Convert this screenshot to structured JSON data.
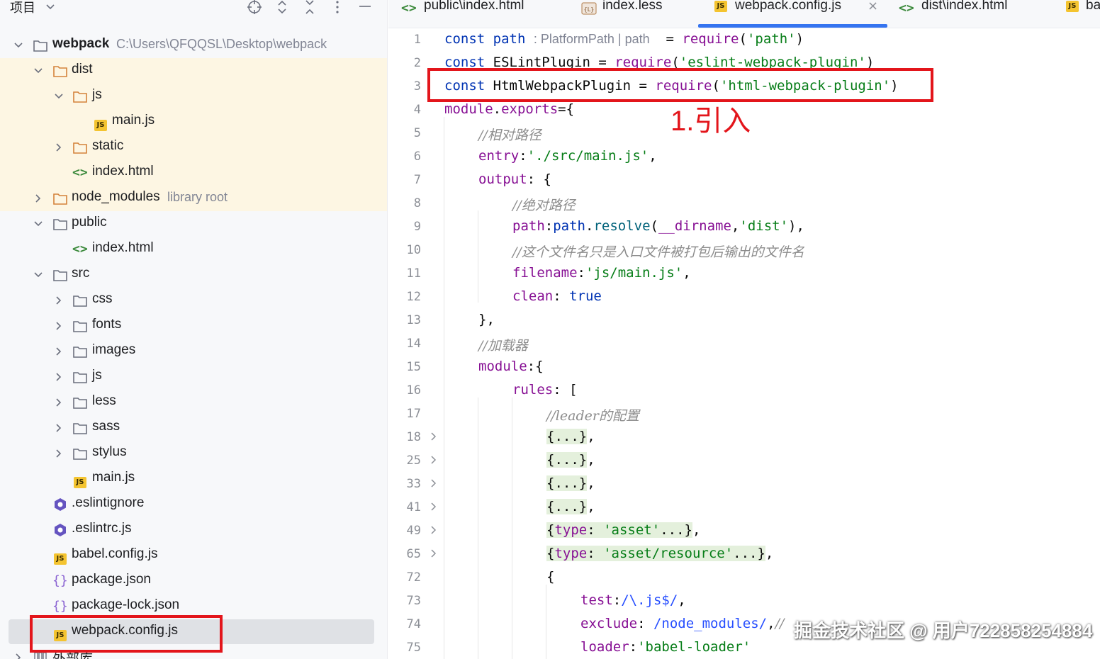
{
  "project_panel": {
    "title": "项目",
    "tree": [
      {
        "label": "webpack",
        "hint": "C:\\Users\\QFQQSL\\Desktop\\webpack"
      },
      {
        "label": "dist"
      },
      {
        "label": "js"
      },
      {
        "label": "main.js"
      },
      {
        "label": "static"
      },
      {
        "label": "index.html"
      },
      {
        "label": "node_modules",
        "hint": "library root"
      },
      {
        "label": "public"
      },
      {
        "label": "index.html"
      },
      {
        "label": "src"
      },
      {
        "label": "css"
      },
      {
        "label": "fonts"
      },
      {
        "label": "images"
      },
      {
        "label": "js"
      },
      {
        "label": "less"
      },
      {
        "label": "sass"
      },
      {
        "label": "stylus"
      },
      {
        "label": "main.js"
      },
      {
        "label": ".eslintignore"
      },
      {
        "label": ".eslintrc.js"
      },
      {
        "label": "babel.config.js"
      },
      {
        "label": "package.json"
      },
      {
        "label": "package-lock.json"
      },
      {
        "label": "webpack.config.js"
      },
      {
        "label": "外部库"
      }
    ]
  },
  "tabs": [
    {
      "label": "public\\index.html",
      "icon": "html-icon"
    },
    {
      "label": "index.less",
      "icon": "less-icon"
    },
    {
      "label": "webpack.config.js",
      "icon": "js-icon",
      "active": true
    },
    {
      "label": "dist\\index.html",
      "icon": "html-icon"
    },
    {
      "label": "ba",
      "icon": "js-icon"
    }
  ],
  "editor": {
    "line_numbers": [
      "1",
      "2",
      "3",
      "4",
      "5",
      "6",
      "7",
      "8",
      "9",
      "10",
      "11",
      "12",
      "13",
      "14",
      "15",
      "16",
      "17",
      "18",
      "25",
      "33",
      "41",
      "49",
      "65",
      "72",
      "73",
      "74",
      "75"
    ],
    "type_hint": ": PlatformPath | path"
  },
  "annotation": {
    "label": "1.引入",
    "color": "#e3151b"
  },
  "watermark": "掘金技术社区 @ 用户7228582548​84"
}
